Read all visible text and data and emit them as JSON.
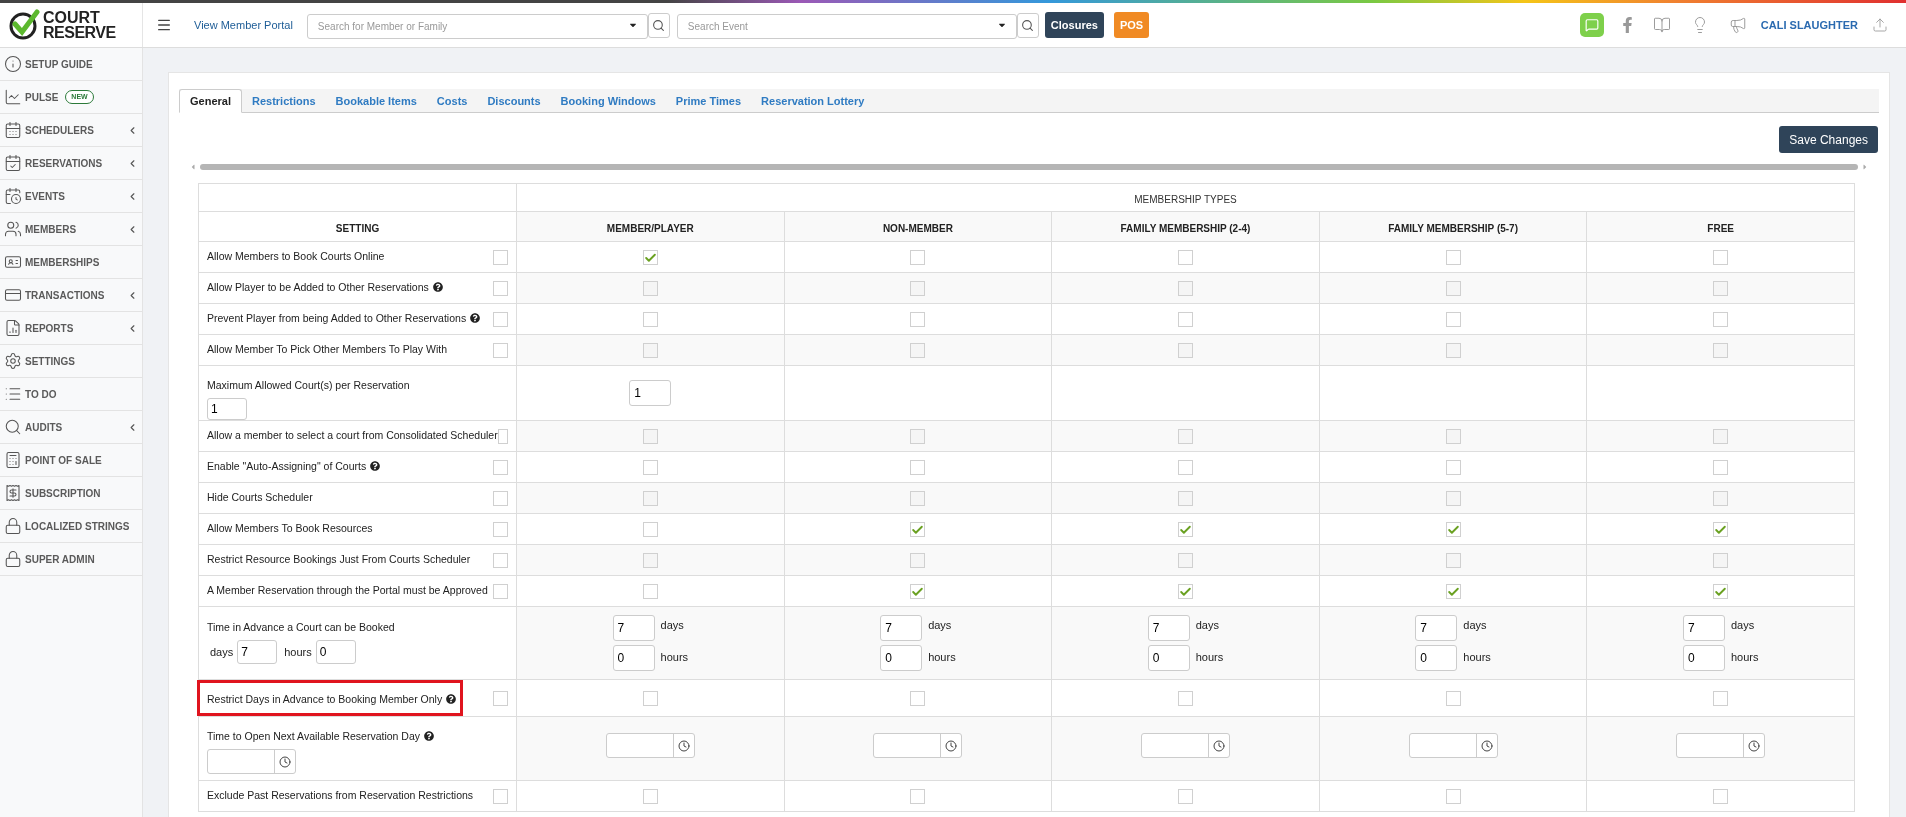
{
  "logo": {
    "line1": "COURT",
    "line2": "RESERVE"
  },
  "topbar": {
    "portal_link": "View Member Portal",
    "member_search": {
      "placeholder": "Search for Member or Family"
    },
    "event_search": {
      "placeholder": "Search Event"
    },
    "buttons": [
      {
        "label": "Closures",
        "kind": "dark"
      },
      {
        "label": "POS",
        "kind": "orange"
      }
    ],
    "user": "CALI SLAUGHTER"
  },
  "sidebar": {
    "items": [
      {
        "label": "SETUP GUIDE",
        "expandable": false
      },
      {
        "label": "PULSE",
        "badge": "NEW",
        "expandable": false
      },
      {
        "label": "SCHEDULERS",
        "expandable": true
      },
      {
        "label": "RESERVATIONS",
        "expandable": true
      },
      {
        "label": "EVENTS",
        "expandable": true
      },
      {
        "label": "MEMBERS",
        "expandable": true
      },
      {
        "label": "MEMBERSHIPS",
        "expandable": false
      },
      {
        "label": "TRANSACTIONS",
        "expandable": true
      },
      {
        "label": "REPORTS",
        "expandable": true
      },
      {
        "label": "SETTINGS",
        "expandable": false
      },
      {
        "label": "TO DO",
        "expandable": false
      },
      {
        "label": "AUDITS",
        "expandable": true
      },
      {
        "label": "POINT OF SALE",
        "expandable": false
      },
      {
        "label": "SUBSCRIPTION",
        "expandable": false
      },
      {
        "label": "LOCALIZED STRINGS",
        "expandable": false
      },
      {
        "label": "SUPER ADMIN",
        "expandable": false
      }
    ]
  },
  "tabs": [
    {
      "label": "General",
      "selected": true
    },
    {
      "label": "Restrictions",
      "selected": false
    },
    {
      "label": "Bookable Items",
      "selected": false
    },
    {
      "label": "Costs",
      "selected": false
    },
    {
      "label": "Discounts",
      "selected": false
    },
    {
      "label": "Booking Windows",
      "selected": false
    },
    {
      "label": "Prime Times",
      "selected": false
    },
    {
      "label": "Reservation Lottery",
      "selected": false
    }
  ],
  "save_button": "Save Changes",
  "table": {
    "group_header": "MEMBERSHIP TYPES",
    "setting_header": "SETTING",
    "columns": [
      "MEMBER/PLAYER",
      "NON-MEMBER",
      "FAMILY MEMBERSHIP (2-4)",
      "FAMILY MEMBERSHIP (5-7)",
      "FREE"
    ],
    "rows": [
      {
        "kind": "check",
        "label": "Allow Members to Book Courts Online",
        "help": false,
        "highlighted": false,
        "checked": false,
        "cells": [
          {
            "checked": true
          },
          {
            "checked": false
          },
          {
            "checked": false
          },
          {
            "checked": false
          },
          {
            "checked": false
          }
        ]
      },
      {
        "kind": "check",
        "label": "Allow Player to be Added to Other Reservations",
        "help": true,
        "highlighted": false,
        "checked": false,
        "cells": [
          {
            "checked": false
          },
          {
            "checked": false
          },
          {
            "checked": false
          },
          {
            "checked": false
          },
          {
            "checked": false
          }
        ]
      },
      {
        "kind": "check",
        "label": "Prevent Player from being Added to Other Reservations",
        "help": true,
        "highlighted": false,
        "checked": false,
        "cells": [
          {
            "checked": false
          },
          {
            "checked": false
          },
          {
            "checked": false
          },
          {
            "checked": false
          },
          {
            "checked": false
          }
        ]
      },
      {
        "kind": "check",
        "label": "Allow Member To Pick Other Members To Play With",
        "help": false,
        "highlighted": false,
        "checked": false,
        "cells": [
          {
            "checked": false
          },
          {
            "checked": false
          },
          {
            "checked": false
          },
          {
            "checked": false
          },
          {
            "checked": false
          }
        ]
      },
      {
        "kind": "number",
        "label": "Maximum Allowed Court(s) per Reservation",
        "value": "1",
        "cells": [
          {
            "value": "1"
          }
        ]
      },
      {
        "kind": "check",
        "label": "Allow a member to select a court from Consolidated Scheduler",
        "help": false,
        "highlighted": false,
        "checked": false,
        "cells": [
          {
            "checked": false
          },
          {
            "checked": false
          },
          {
            "checked": false
          },
          {
            "checked": false
          },
          {
            "checked": false
          }
        ]
      },
      {
        "kind": "check",
        "label": "Enable \"Auto-Assigning\" of Courts",
        "help": true,
        "highlighted": false,
        "checked": false,
        "cells": [
          {
            "checked": false
          },
          {
            "checked": false
          },
          {
            "checked": false
          },
          {
            "checked": false
          },
          {
            "checked": false
          }
        ]
      },
      {
        "kind": "check",
        "label": "Hide Courts Scheduler",
        "help": false,
        "highlighted": false,
        "checked": false,
        "cells": [
          {
            "checked": false
          },
          {
            "checked": false
          },
          {
            "checked": false
          },
          {
            "checked": false
          },
          {
            "checked": false
          }
        ]
      },
      {
        "kind": "check",
        "label": "Allow Members To Book Resources",
        "help": false,
        "highlighted": false,
        "checked": false,
        "cells": [
          {
            "checked": false
          },
          {
            "checked": true
          },
          {
            "checked": true
          },
          {
            "checked": true
          },
          {
            "checked": true
          }
        ]
      },
      {
        "kind": "check",
        "label": "Restrict Resource Bookings Just From Courts Scheduler",
        "help": false,
        "highlighted": false,
        "checked": false,
        "cells": [
          {
            "checked": false
          },
          {
            "checked": false
          },
          {
            "checked": false
          },
          {
            "checked": false
          },
          {
            "checked": false
          }
        ]
      },
      {
        "kind": "check",
        "label": "A Member Reservation through the Portal must be Approved",
        "help": false,
        "highlighted": false,
        "checked": false,
        "cells": [
          {
            "checked": false
          },
          {
            "checked": true
          },
          {
            "checked": true
          },
          {
            "checked": true
          },
          {
            "checked": true
          }
        ]
      },
      {
        "kind": "advance",
        "label": "Time in Advance a Court can be Booked",
        "days_label": "days",
        "days": "7",
        "hours_label": "hours",
        "hours": "0",
        "cells": [
          {
            "days": "7",
            "days_label": "days",
            "hours": "0",
            "hours_label": "hours"
          },
          {
            "days": "7",
            "days_label": "days",
            "hours": "0",
            "hours_label": "hours"
          },
          {
            "days": "7",
            "days_label": "days",
            "hours": "0",
            "hours_label": "hours"
          },
          {
            "days": "7",
            "days_label": "days",
            "hours": "0",
            "hours_label": "hours"
          },
          {
            "days": "7",
            "days_label": "days",
            "hours": "0",
            "hours_label": "hours"
          }
        ]
      },
      {
        "kind": "check",
        "label": "Restrict Days in Advance to Booking Member Only",
        "help": true,
        "highlighted": true,
        "checked": false,
        "cells": [
          {
            "checked": false
          },
          {
            "checked": false
          },
          {
            "checked": false
          },
          {
            "checked": false
          },
          {
            "checked": false
          }
        ]
      },
      {
        "kind": "time",
        "label": "Time to Open Next Available Reservation Day",
        "help": true
      },
      {
        "kind": "check",
        "label": "Exclude Past Reservations from Reservation Restrictions",
        "help": false,
        "highlighted": false,
        "checked": false,
        "cells": [
          {
            "checked": false
          },
          {
            "checked": false
          },
          {
            "checked": false
          },
          {
            "checked": false
          },
          {
            "checked": false
          }
        ]
      }
    ]
  }
}
